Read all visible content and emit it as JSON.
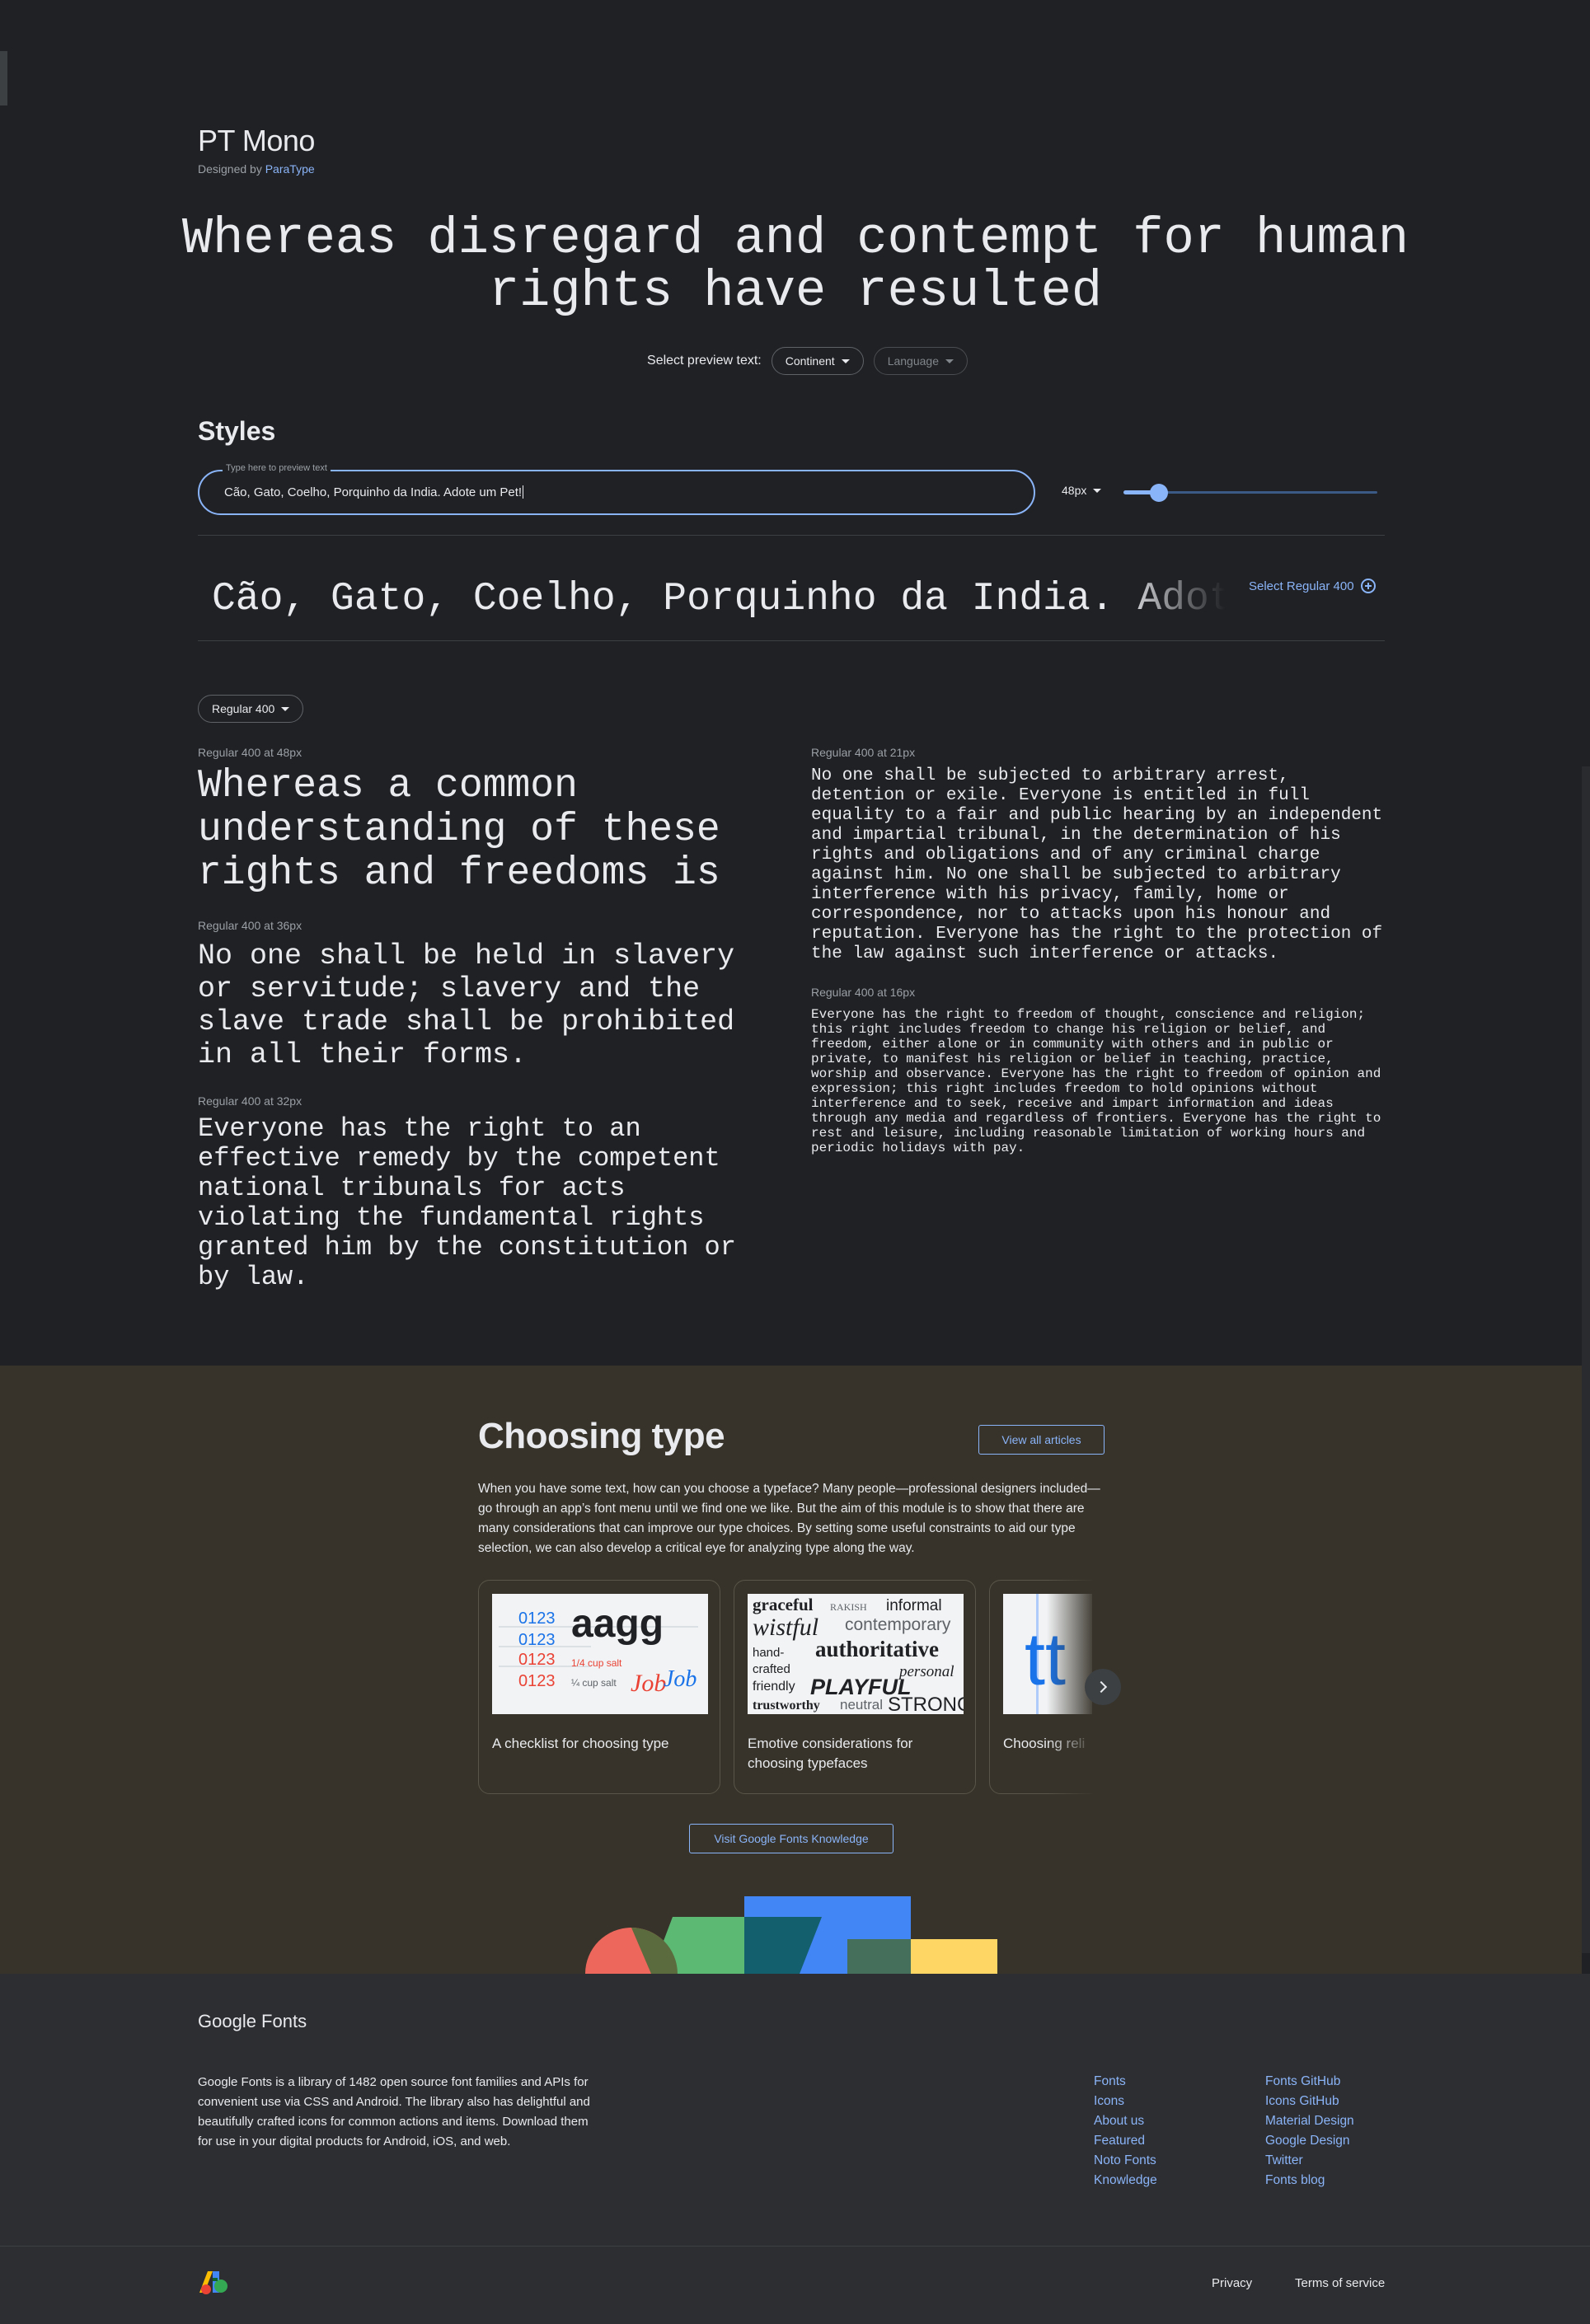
{
  "family": {
    "name": "PT Mono",
    "designed_by": "Designed by",
    "designer": "ParaType"
  },
  "hero": {
    "text": "Whereas disregard and contempt for human rights have resulted"
  },
  "preview": {
    "label": "Select preview text:",
    "continent": "Continent",
    "language": "Language"
  },
  "styles": {
    "title": "Styles",
    "field_label": "Type here to preview text",
    "field_value": "Cão, Gato, Coelho, Porquinho da India. Adote um Pet!",
    "size": "48px",
    "size_fraction": 0.14,
    "sample": "Cão, Gato, Coelho, Porquinho da India. Adote um Pet!",
    "select_label": "Select Regular 400",
    "style_dropdown": "Regular 400"
  },
  "specimens": [
    {
      "caption": "Regular 400 at 48px",
      "text": "Whereas a common understanding of these rights and freedoms is"
    },
    {
      "caption": "Regular 400 at 36px",
      "text": "No one shall be held in slavery or servitude; slavery and the slave trade shall be prohibited in all their forms."
    },
    {
      "caption": "Regular 400 at 32px",
      "text": "Everyone has the right to an effective remedy by the competent national tribunals for acts violating the fundamental rights granted him by the constitution or by law."
    },
    {
      "caption": "Regular 400 at 21px",
      "text": "No one shall be subjected to arbitrary arrest, detention or exile. Everyone is entitled in full equality to a fair and public hearing by an independent and impartial tribunal, in the determination of his rights and obligations and of any criminal charge against him. No one shall be subjected to arbitrary interference with his privacy, family, home or correspondence, nor to attacks upon his honour and reputation. Everyone has the right to the protection of the law against such interference or attacks."
    },
    {
      "caption": "Regular 400 at 16px",
      "text": "Everyone has the right to freedom of thought, conscience and religion; this right includes freedom to change his religion or belief, and freedom, either alone or in community with others and in public or private, to manifest his religion or belief in teaching, practice, worship and observance. Everyone has the right to freedom of opinion and expression; this right includes freedom to hold opinions without interference and to seek, receive and impart information and ideas through any media and regardless of frontiers. Everyone has the right to rest and leisure, including reasonable limitation of working hours and periodic holidays with pay."
    }
  ],
  "articles": {
    "title": "Choosing type",
    "view_all": "View all articles",
    "description": "When you have some text, how can you choose a typeface? Many people—professional designers included—go through an app’s font menu until we find one we like. But the aim of this module is to show that there are many considerations that can improve our type choices. By setting some useful constraints to aid our type selection, we can also develop a critical eye for analyzing type along the way.",
    "cards": [
      {
        "title": "A checklist for choosing type"
      },
      {
        "title": "Emotive considerations for choosing typefaces"
      },
      {
        "title": "Choosing reli"
      }
    ],
    "card1_art": {
      "nums": [
        "0123",
        "0123",
        "0123",
        "0123"
      ],
      "big": "aagg",
      "salt1": "1/4 cup salt",
      "salt2": "¼ cup salt",
      "job1": "Job",
      "job2": "Job"
    },
    "card2_art": {
      "row1a": "graceful",
      "row1b": "RAKISH",
      "row1c": "informal",
      "row2a": "wistful",
      "row2b": "contemporary",
      "row3a": "hand-",
      "row3b": "authoritative",
      "row4a": "crafted",
      "row4b": "personal",
      "row5a": "friendly",
      "row5b": "PLAYFUL",
      "row6a": "trustworthy",
      "row6b": "neutral",
      "row6c": "STRONG"
    },
    "card3_art": {
      "glyphs": "tt"
    },
    "visit": "Visit Google Fonts Knowledge"
  },
  "footer": {
    "brand": "Google Fonts",
    "description": "Google Fonts is a library of 1482 open source font families and APIs for convenient use via CSS and Android. The library also has delightful and beautifully crafted icons for common actions and items. Download them for use in your digital products for Android, iOS, and web.",
    "col1": [
      "Fonts",
      "Icons",
      "About us",
      "Featured",
      "Noto Fonts",
      "Knowledge"
    ],
    "col2": [
      "Fonts GitHub",
      "Icons GitHub",
      "Material Design",
      "Google Design",
      "Twitter",
      "Fonts blog"
    ],
    "privacy": "Privacy",
    "terms": "Terms of service"
  },
  "colors": {
    "background": "#202124",
    "accent": "#8ab4f8",
    "articles_bg": "#37332a",
    "footer_bg": "#2d2e31"
  }
}
